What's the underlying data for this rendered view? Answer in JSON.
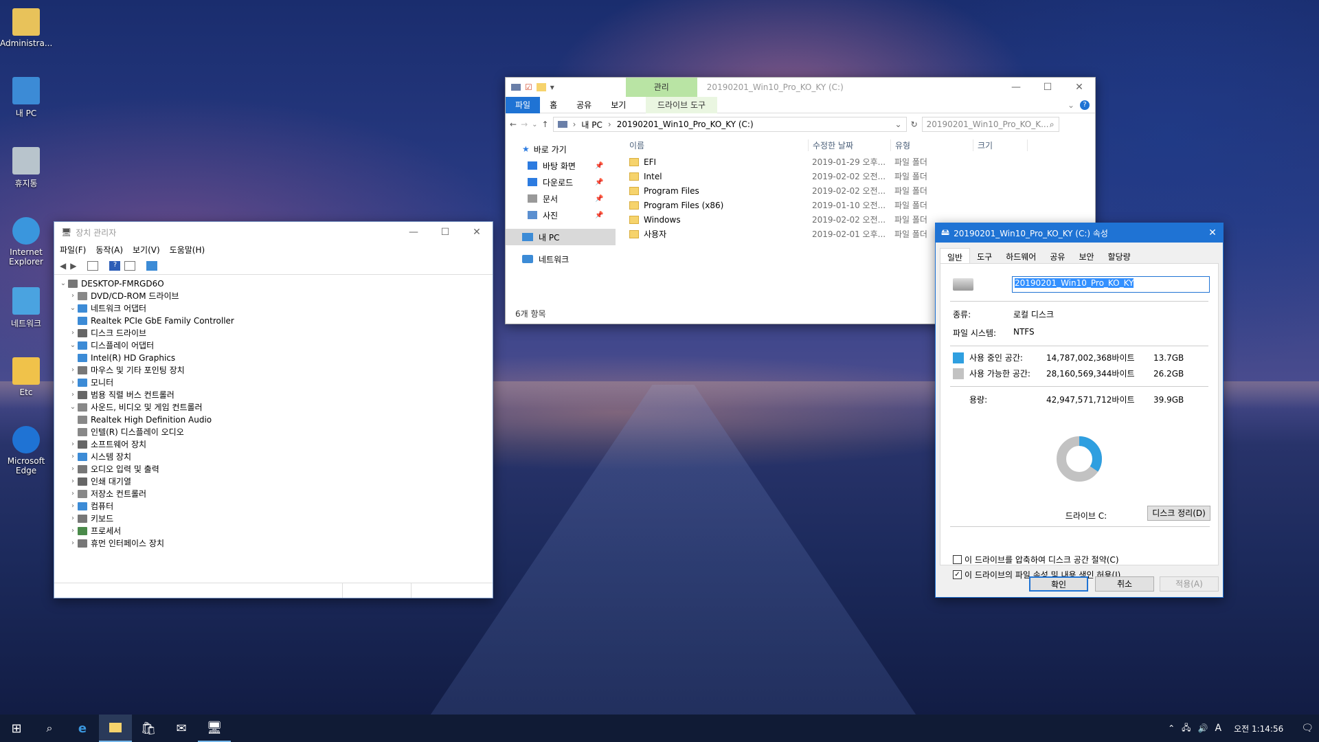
{
  "desktop": {
    "icons": [
      {
        "label": "Administra...",
        "icon": "user-folder-icon"
      },
      {
        "label": "내 PC",
        "icon": "computer-icon"
      },
      {
        "label": "휴지통",
        "icon": "recycle-bin-icon"
      },
      {
        "label": "Internet Explorer",
        "icon": "ie-icon"
      },
      {
        "label": "네트워크",
        "icon": "network-icon"
      },
      {
        "label": "Etc",
        "icon": "etc-icon"
      },
      {
        "label": "Microsoft Edge",
        "icon": "edge-icon"
      }
    ]
  },
  "devmgr": {
    "title": "장치 관리자",
    "menu": [
      "파일(F)",
      "동작(A)",
      "보기(V)",
      "도움말(H)"
    ],
    "root": "DESKTOP-FMRGD6O",
    "items": [
      {
        "label": "DVD/CD-ROM 드라이브",
        "open": false,
        "level": 1,
        "color": "#888"
      },
      {
        "label": "네트워크 어댑터",
        "open": true,
        "level": 1,
        "color": "#3c8bd6"
      },
      {
        "label": "Realtek PCIe GbE Family Controller",
        "level": 2,
        "color": "#3c8bd6"
      },
      {
        "label": "디스크 드라이브",
        "open": false,
        "level": 1,
        "color": "#666"
      },
      {
        "label": "디스플레이 어댑터",
        "open": true,
        "level": 1,
        "color": "#3c8bd6"
      },
      {
        "label": "Intel(R) HD Graphics",
        "level": 2,
        "color": "#3c8bd6"
      },
      {
        "label": "마우스 및 기타 포인팅 장치",
        "open": false,
        "level": 1,
        "color": "#777"
      },
      {
        "label": "모니터",
        "open": false,
        "level": 1,
        "color": "#3c8bd6"
      },
      {
        "label": "범용 직렬 버스 컨트롤러",
        "open": false,
        "level": 1,
        "color": "#666"
      },
      {
        "label": "사운드, 비디오 및 게임 컨트롤러",
        "open": true,
        "level": 1,
        "color": "#888"
      },
      {
        "label": "Realtek High Definition Audio",
        "level": 2,
        "color": "#888"
      },
      {
        "label": "인텔(R) 디스플레이 오디오",
        "level": 2,
        "color": "#888"
      },
      {
        "label": "소프트웨어 장치",
        "open": false,
        "level": 1,
        "color": "#666"
      },
      {
        "label": "시스템 장치",
        "open": false,
        "level": 1,
        "color": "#3c8bd6"
      },
      {
        "label": "오디오 입력 및 출력",
        "open": false,
        "level": 1,
        "color": "#777"
      },
      {
        "label": "인쇄 대기열",
        "open": false,
        "level": 1,
        "color": "#666"
      },
      {
        "label": "저장소 컨트롤러",
        "open": false,
        "level": 1,
        "color": "#888"
      },
      {
        "label": "컴퓨터",
        "open": false,
        "level": 1,
        "color": "#3c8bd6"
      },
      {
        "label": "키보드",
        "open": false,
        "level": 1,
        "color": "#777"
      },
      {
        "label": "프로세서",
        "open": false,
        "level": 1,
        "color": "#4a8a4a"
      },
      {
        "label": "휴먼 인터페이스 장치",
        "open": false,
        "level": 1,
        "color": "#777"
      }
    ]
  },
  "explorer": {
    "title": "20190201_Win10_Pro_KO_KY (C:)",
    "context_tab": "관리",
    "context_sub": "드라이브 도구",
    "ribbon_tabs": [
      "파일",
      "홈",
      "공유",
      "보기"
    ],
    "breadcrumb": [
      "내 PC",
      "20190201_Win10_Pro_KO_KY (C:)"
    ],
    "search_placeholder": "20190201_Win10_Pro_KO_K...",
    "nav": {
      "quick": "바로 가기",
      "pinned": [
        "바탕 화면",
        "다운로드",
        "문서",
        "사진"
      ],
      "pc": "내 PC",
      "network": "네트워크"
    },
    "columns": [
      "이름",
      "수정한 날짜",
      "유형",
      "크기"
    ],
    "files": [
      {
        "name": "EFI",
        "date": "2019-01-29 오후...",
        "type": "파일 폴더"
      },
      {
        "name": "Intel",
        "date": "2019-02-02 오전...",
        "type": "파일 폴더"
      },
      {
        "name": "Program Files",
        "date": "2019-02-02 오전...",
        "type": "파일 폴더"
      },
      {
        "name": "Program Files (x86)",
        "date": "2019-01-10 오전...",
        "type": "파일 폴더"
      },
      {
        "name": "Windows",
        "date": "2019-02-02 오전...",
        "type": "파일 폴더"
      },
      {
        "name": "사용자",
        "date": "2019-02-01 오후...",
        "type": "파일 폴더"
      }
    ],
    "status": "6개 항목"
  },
  "props": {
    "title": "20190201_Win10_Pro_KO_KY (C:) 속성",
    "tabs": [
      "일반",
      "도구",
      "하드웨어",
      "공유",
      "보안",
      "할당량"
    ],
    "name_value": "20190201_Win10_Pro_KO_KY",
    "type_label": "종류:",
    "type_value": "로컬 디스크",
    "fs_label": "파일 시스템:",
    "fs_value": "NTFS",
    "used_label": "사용 중인 공간:",
    "used_bytes": "14,787,002,368바이트",
    "used_gb": "13.7GB",
    "free_label": "사용 가능한 공간:",
    "free_bytes": "28,160,569,344바이트",
    "free_gb": "26.2GB",
    "cap_label": "용량:",
    "cap_bytes": "42,947,571,712바이트",
    "cap_gb": "39.9GB",
    "drive_label": "드라이브 C:",
    "cleanup": "디스크 정리(D)",
    "compress": "이 드라이브를 압축하여 디스크 공간 절약(C)",
    "index": "이 드라이브의 파일 속성 및 내용 색인 허용(I)",
    "ok": "확인",
    "cancel": "취소",
    "apply": "적용(A)",
    "used_fraction": 0.344,
    "colors": {
      "used": "#2f9fe0",
      "free": "#c2c2c2"
    }
  },
  "taskbar": {
    "time": "오전 1:14:56",
    "ime": "A"
  }
}
